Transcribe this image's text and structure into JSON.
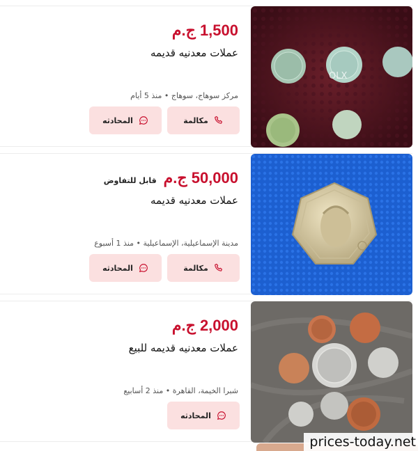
{
  "listings": [
    {
      "price": "1,500 ج.م",
      "negotiable": "",
      "title": "عملات معدنيه قديمه",
      "location": "مركز سوهاج، سوهاج • منذ 5 أيام",
      "call_label": "مكالمة",
      "chat_label": "المحادثه",
      "image": "coins-on-maroon-fabric"
    },
    {
      "price": "50,000 ج.م",
      "negotiable": "قابل للتفاوض",
      "title": "عملات معدنيه قديمه",
      "location": "مدينة الإسماعيلية، الإسماعيلية • منذ 1 أسبوع",
      "call_label": "مكالمة",
      "chat_label": "المحادثه",
      "image": "heptagonal-coin-on-blue-fabric"
    },
    {
      "price": "2,000 ج.م",
      "negotiable": "",
      "title": "عملات معدنيه قديمه للبيع",
      "location": "شبرا الخيمة، القاهرة • منذ 2 أسابيع",
      "chat_label": "المحادثه",
      "image": "mixed-coins-on-grey-fabric"
    }
  ],
  "watermark": "prices-today.net",
  "colors": {
    "price": "#c8102e",
    "button_bg": "#fbe0e0",
    "icon": "#c8102e"
  }
}
